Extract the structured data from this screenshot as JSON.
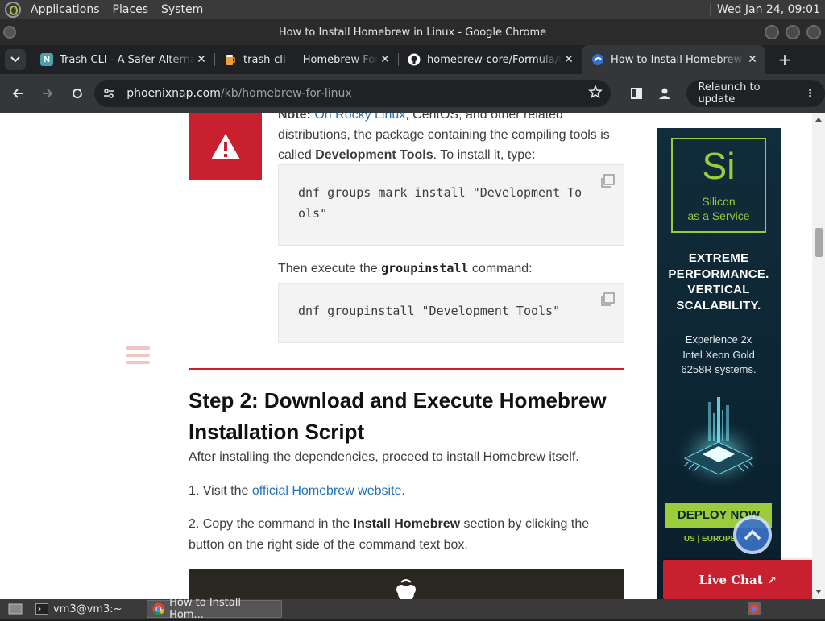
{
  "top_panel": {
    "menus": [
      "Applications",
      "Places",
      "System"
    ],
    "clock": "Wed Jan 24, 09:01"
  },
  "window": {
    "title": "How to Install Homebrew in Linux - Google Chrome"
  },
  "tabs": [
    {
      "label": "Trash CLI - A Safer Alternative",
      "favicon": "N",
      "favicon_color": "#4aa0b0"
    },
    {
      "label": "trash-cli — Homebrew Formulae",
      "favicon": "beer-icon",
      "favicon_color": "#f0a030"
    },
    {
      "label": "homebrew-core/Formula/t",
      "favicon": "github-icon",
      "favicon_color": "#ffffff"
    },
    {
      "label": "How to Install Homebrew in Linux",
      "favicon": "phoenixnap-icon",
      "favicon_color": "#2f6fd8",
      "active": true
    }
  ],
  "toolbar": {
    "url_host": "phoenixnap.com",
    "url_path": "/kb/homebrew-for-linux",
    "relaunch_label": "Relaunch to update"
  },
  "article": {
    "note_bold": "Note:",
    "note_link1": "On Rocky Linux",
    "note_rest1": ", CentOS, and other related distributions, the package containing the compiling tools is called ",
    "note_bold2": "Development Tools",
    "note_rest2": ". To install it, type:",
    "code1_line1": "dnf groups mark install \"Development To",
    "code1_line2": "ols\"",
    "then_text1": "Then execute the ",
    "then_code": "groupinstall",
    "then_text2": " command:",
    "code2": "dnf groupinstall \"Development Tools\"",
    "heading": "Step 2: Download and Execute Homebrew Installation Script",
    "after_text": "After installing the dependencies, proceed to install Homebrew itself.",
    "step1_prefix": "1. Visit the ",
    "step1_link": "official Homebrew website",
    "step1_suffix": ".",
    "step2_prefix": "2. Copy the command in the ",
    "step2_bold": "Install Homebrew",
    "step2_suffix": " section by clicking the button on the right side of the command text box."
  },
  "ad": {
    "logo": "Si",
    "tagline_line1": "Silicon",
    "tagline_line2": "as a Service",
    "perf_line1": "EXTREME",
    "perf_line2": "PERFORMANCE.",
    "perf_line3": "VERTICAL",
    "perf_line4": "SCALABILITY.",
    "exp_line1": "Experience 2x",
    "exp_line2": "Intel Xeon Gold",
    "exp_line3": "6258R systems.",
    "cta": "DEPLOY NOW",
    "regions": "US | EUROPE | AS"
  },
  "live_chat": "Live Chat ↗",
  "taskbar": {
    "items": [
      {
        "label": "vm3@vm3:~",
        "icon": "terminal-icon"
      },
      {
        "label": "How to Install Hom...",
        "icon": "chrome-icon",
        "active": true
      }
    ]
  }
}
